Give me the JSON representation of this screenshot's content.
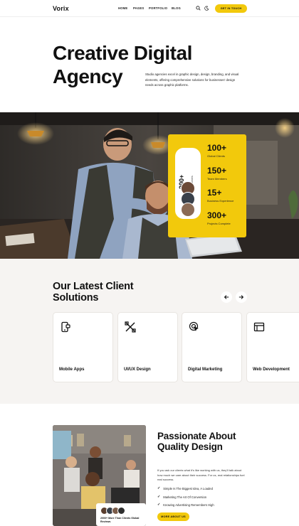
{
  "header": {
    "logo": "Vorix",
    "nav": [
      "HOME",
      "PAGES",
      "PORTFOLIO",
      "BLOG"
    ],
    "cta_label": "GET IN TOUCH"
  },
  "hero": {
    "title_line1": "Creative Digital",
    "title_line2": "Agency",
    "description": "Studio agencies excel in graphic design, design, branding, and visual elements, offering comprehensive solutions for businesses' design needs across graphic platforms."
  },
  "stats": {
    "pill_number": "200+",
    "pill_label": "satisfied customers",
    "items": [
      {
        "value": "100+",
        "label": "Global Clients"
      },
      {
        "value": "150+",
        "label": "Team Members"
      },
      {
        "value": "15+",
        "label": "Business Experience"
      },
      {
        "value": "300+",
        "label": "Projects Complete"
      }
    ]
  },
  "solutions": {
    "title": "Our Latest Client Solutions",
    "cards": [
      {
        "label": "Mobile Apps",
        "icon": "mobile-icon"
      },
      {
        "label": "UI/UX Design",
        "icon": "design-tools-icon"
      },
      {
        "label": "Digital Marketing",
        "icon": "cursor-click-icon"
      },
      {
        "label": "Web Development",
        "icon": "browser-window-icon"
      }
    ]
  },
  "quality": {
    "title": "Passionate About Quality Design",
    "description": "If you ask our clients what it's like working with us, they'll talk about how much we care about their success. For us, real relationships fuel real success.",
    "checks": [
      "Simple Is The Biggest Idea, A Loaded",
      "Marketing The Art Of Conversion",
      "Knowing Advertising Remembers High"
    ],
    "badge_text": "2000+ More Than Clients Global Reviews",
    "button_label": "MORE ABOUT US"
  },
  "colors": {
    "accent": "#f2c90c",
    "dark": "#111111",
    "section_bg": "#f6f4f2"
  }
}
